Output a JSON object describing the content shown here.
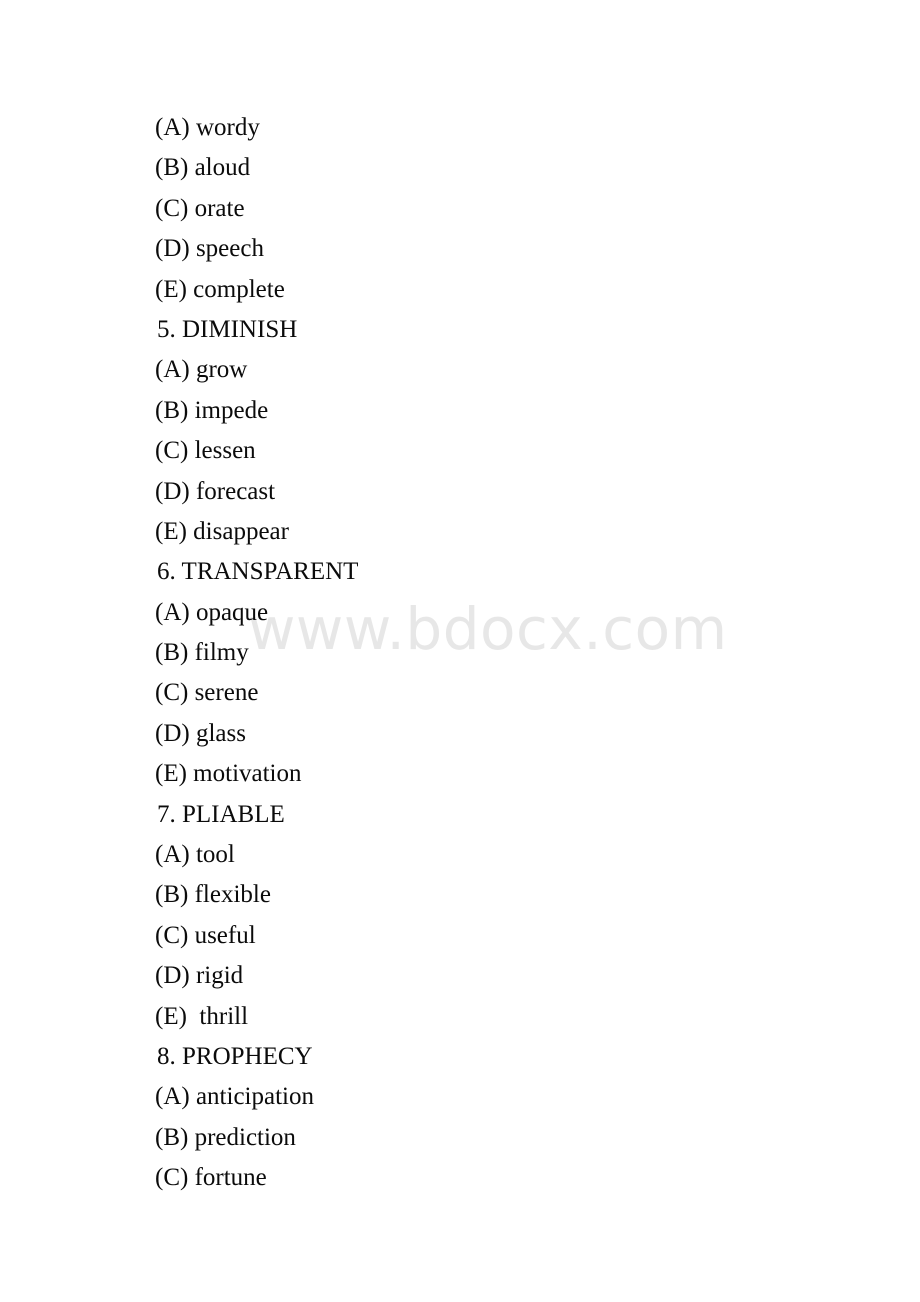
{
  "document": {
    "type": "vocabulary-multiple-choice-test",
    "watermark": "www.bdocx.com",
    "watermark_color": "#e7e7e7",
    "page_background": "#ffffff",
    "text_color": "#0b0b0b",
    "lines": [
      {
        "kind": "option",
        "text": "(A) wordy"
      },
      {
        "kind": "option",
        "text": "(B) aloud"
      },
      {
        "kind": "option",
        "text": "(C) orate"
      },
      {
        "kind": "option",
        "text": "(D) speech"
      },
      {
        "kind": "option",
        "text": "(E) complete"
      },
      {
        "kind": "heading",
        "text": "5. DIMINISH"
      },
      {
        "kind": "option",
        "text": "(A) grow"
      },
      {
        "kind": "option",
        "text": "(B) impede"
      },
      {
        "kind": "option",
        "text": "(C) lessen"
      },
      {
        "kind": "option",
        "text": "(D) forecast"
      },
      {
        "kind": "option",
        "text": "(E) disappear"
      },
      {
        "kind": "heading",
        "text": "6. TRANSPARENT"
      },
      {
        "kind": "option",
        "text": "(A) opaque"
      },
      {
        "kind": "option",
        "text": "(B) filmy"
      },
      {
        "kind": "option",
        "text": "(C) serene"
      },
      {
        "kind": "option",
        "text": "(D) glass"
      },
      {
        "kind": "option",
        "text": "(E) motivation"
      },
      {
        "kind": "heading",
        "text": "7. PLIABLE"
      },
      {
        "kind": "option",
        "text": "(A) tool"
      },
      {
        "kind": "option",
        "text": "(B) flexible"
      },
      {
        "kind": "option",
        "text": "(C) useful"
      },
      {
        "kind": "option",
        "text": "(D) rigid"
      },
      {
        "kind": "option",
        "text": "(E)  thrill"
      },
      {
        "kind": "heading",
        "text": "8. PROPHECY"
      },
      {
        "kind": "option",
        "text": "(A) anticipation"
      },
      {
        "kind": "option",
        "text": "(B) prediction"
      },
      {
        "kind": "option",
        "text": "(C) fortune"
      }
    ]
  }
}
